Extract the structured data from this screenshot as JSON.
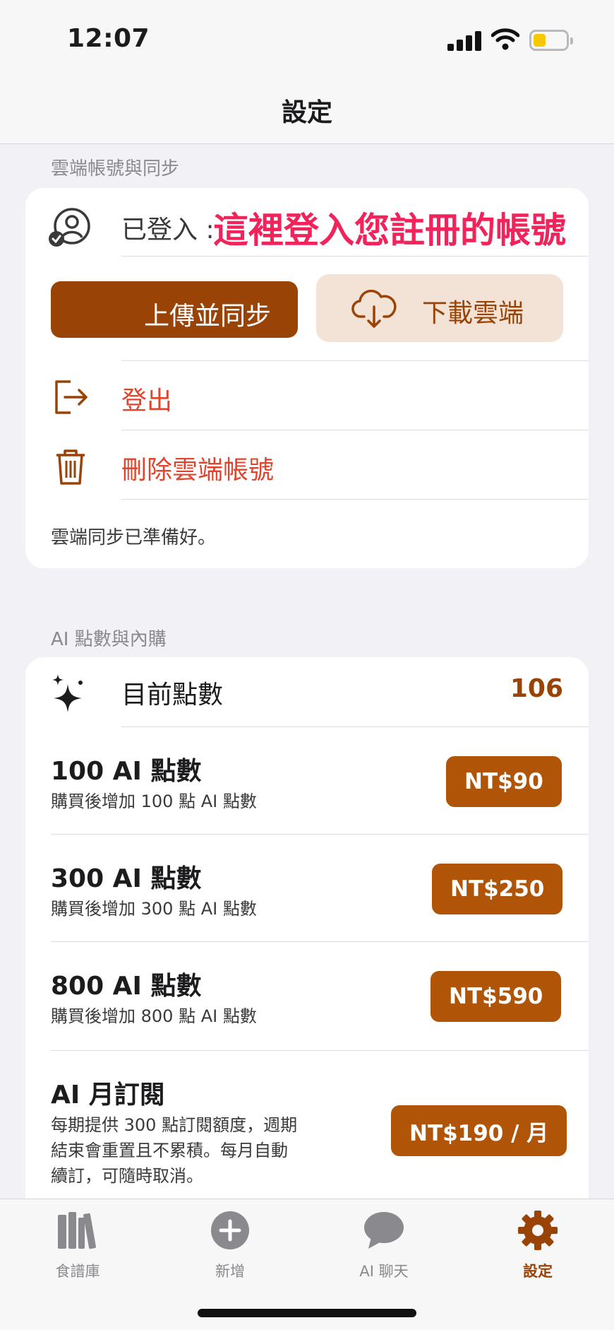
{
  "status_bar": {
    "time": "12:07"
  },
  "nav": {
    "title": "設定"
  },
  "cloud_section": {
    "header": "雲端帳號與同步",
    "login_label": "已登入 :",
    "annotation": "這裡登入您註冊的帳號",
    "upload_button": "上傳並同步",
    "download_button": "下載雲端",
    "logout": "登出",
    "delete_account": "刪除雲端帳號",
    "footnote": "雲端同步已準備好。"
  },
  "ai_section": {
    "header": "AI 點數與內購",
    "current_points_label": "目前點數",
    "current_points_value": "106",
    "products": [
      {
        "title": "100 AI 點數",
        "desc": "購買後增加 100 點 AI 點數",
        "price": "NT$90"
      },
      {
        "title": "300 AI 點數",
        "desc": "購買後增加 300 點 AI 點數",
        "price": "NT$250"
      },
      {
        "title": "800 AI 點數",
        "desc": "購買後增加 800 點 AI 點數",
        "price": "NT$590"
      },
      {
        "title": "AI 月訂閱",
        "desc_lines": [
          "每期提供 300 點訂閱額度，週期",
          "結束會重置且不累積。每月自動",
          "續訂，可隨時取消。"
        ],
        "price": "NT$190 / 月"
      }
    ]
  },
  "tabbar": {
    "tabs": [
      {
        "label": "食譜庫",
        "icon": "books-icon"
      },
      {
        "label": "新增",
        "icon": "plus-circle-icon"
      },
      {
        "label": "AI 聊天",
        "icon": "chat-bubble-icon"
      },
      {
        "label": "設定",
        "icon": "gear-icon"
      }
    ],
    "active": "設定"
  },
  "colors": {
    "accent": "#9a4306",
    "price_button": "#b05508",
    "destructive": "#e0442c",
    "annotation": "#f0245a",
    "download_bg": "#f3e3d7"
  }
}
